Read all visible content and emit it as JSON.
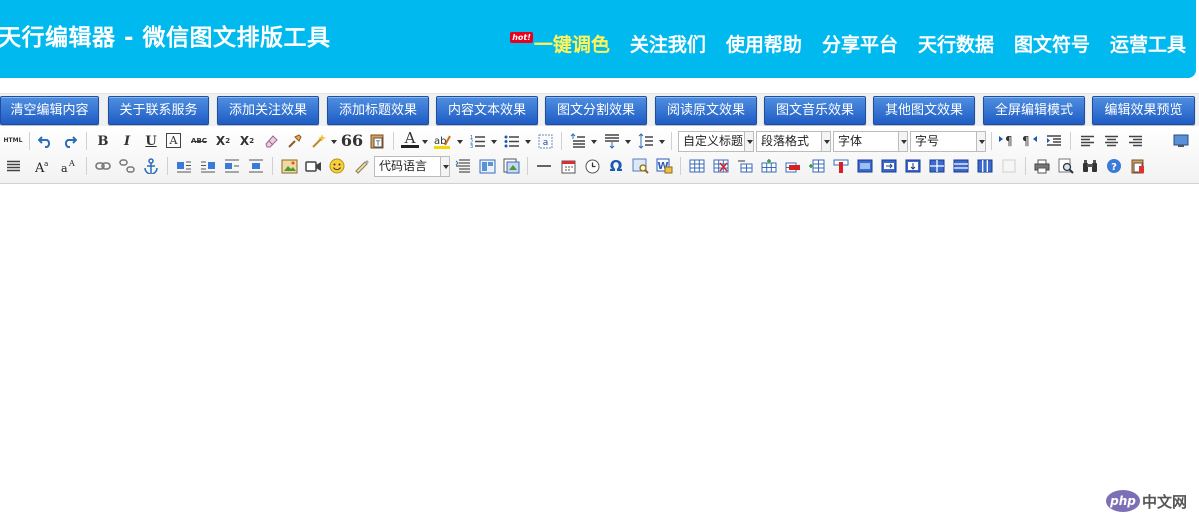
{
  "header": {
    "title": "天行编辑器 - 微信图文排版工具",
    "hot_badge": "hot!",
    "nav": [
      {
        "label": "一键调色",
        "hot": true
      },
      {
        "label": "关注我们"
      },
      {
        "label": "使用帮助"
      },
      {
        "label": "分享平台"
      },
      {
        "label": "天行数据"
      },
      {
        "label": "图文符号"
      },
      {
        "label": "运营工具"
      }
    ]
  },
  "tabs": [
    "清空编辑内容",
    "关于联系服务",
    "添加关注效果",
    "添加标题效果",
    "内容文本效果",
    "图文分割效果",
    "阅读原文效果",
    "图文音乐效果",
    "其他图文效果",
    "全屏编辑模式",
    "编辑效果预览"
  ],
  "toolbar": {
    "html_label": "HTML",
    "bold": "B",
    "italic": "I",
    "underline": "U",
    "fontborder": "A",
    "strike": "ABC",
    "blockquote": "66",
    "forecolor": "A",
    "fontfamily_label": "字体",
    "combos": {
      "custom_title": "自定义标题",
      "paragraph": "段落格式",
      "font_family": "字体",
      "font_size": "字号",
      "code_language": "代码语言"
    },
    "omega": "Ω"
  },
  "colors": {
    "header_bg": "#00b9ee",
    "hot_text": "#fff45a",
    "tab_blue": "#2a6ad0"
  },
  "watermark": {
    "logo": "php",
    "text": "中文网"
  }
}
